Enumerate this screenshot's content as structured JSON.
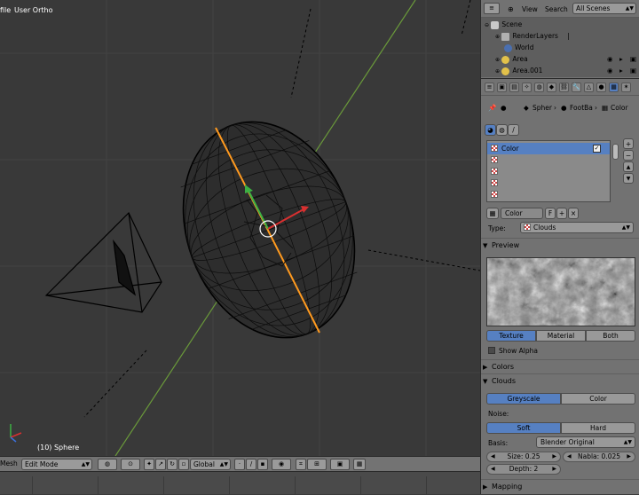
{
  "viewport": {
    "view_name": "User Ortho",
    "object_info": "(10) Sphere",
    "left_clip": "file"
  },
  "header3d": {
    "mesh_label": "Mesh",
    "mode": "Edit Mode",
    "orientation": "Global"
  },
  "outliner": {
    "view_label": "View",
    "search_label": "Search",
    "scenes_select": "All Scenes",
    "items": [
      {
        "label": "Scene"
      },
      {
        "label": "RenderLayers"
      },
      {
        "label": "World"
      },
      {
        "label": "Area"
      },
      {
        "label": "Area.001"
      }
    ]
  },
  "breadcrumb": {
    "item1": "Spher",
    "item2": "FootBa",
    "item3": "Color"
  },
  "texture": {
    "slots": [
      "Color",
      "",
      "",
      "",
      ""
    ],
    "name": "Color",
    "users_flag": "F",
    "type_label": "Type:",
    "type_value": "Clouds"
  },
  "preview": {
    "title": "Preview",
    "tabs": [
      "Texture",
      "Material",
      "Both"
    ],
    "show_alpha": "Show Alpha"
  },
  "colors_panel": {
    "title": "Colors"
  },
  "clouds": {
    "title": "Clouds",
    "greyscale": "Greyscale",
    "color": "Color",
    "noise_label": "Noise:",
    "soft": "Soft",
    "hard": "Hard",
    "basis_label": "Basis:",
    "basis_value": "Blender Original",
    "size": "Size: 0.25",
    "nabla": "Nabla: 0.025",
    "depth": "Depth: 2"
  },
  "mapping": {
    "title": "Mapping"
  },
  "colors": {
    "viewport_bg": "#393939",
    "accent": "#5680c2",
    "seam": "#ff9a1f",
    "panel": "#727272"
  }
}
